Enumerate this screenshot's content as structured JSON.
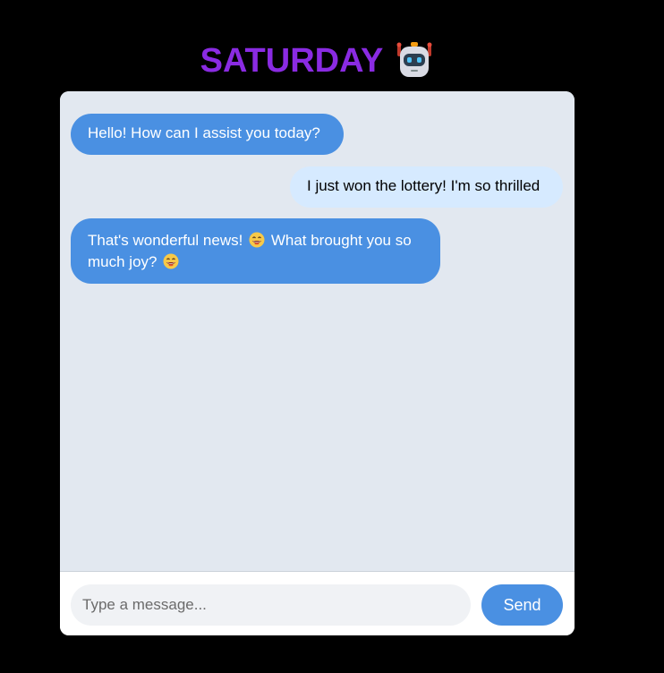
{
  "header": {
    "title": "SATURDAY",
    "icon": "robot-icon"
  },
  "chat": {
    "messages": [
      {
        "sender": "bot",
        "text": "Hello! How can I assist you today?"
      },
      {
        "sender": "user",
        "text": "I just won the lottery! I'm so thrilled"
      },
      {
        "sender": "bot",
        "text_part1": "That's wonderful news!",
        "emoji": "grinning-face-icon",
        "text_part2": "What brought you so much joy?"
      }
    ]
  },
  "composer": {
    "placeholder": "Type a message...",
    "value": "",
    "send_label": "Send"
  },
  "colors": {
    "title": "#8a2be2",
    "bot_bubble": "#4a90e2",
    "user_bubble": "#d6eaff",
    "chat_background": "#e2e8f0",
    "send_button": "#4a90e2"
  }
}
